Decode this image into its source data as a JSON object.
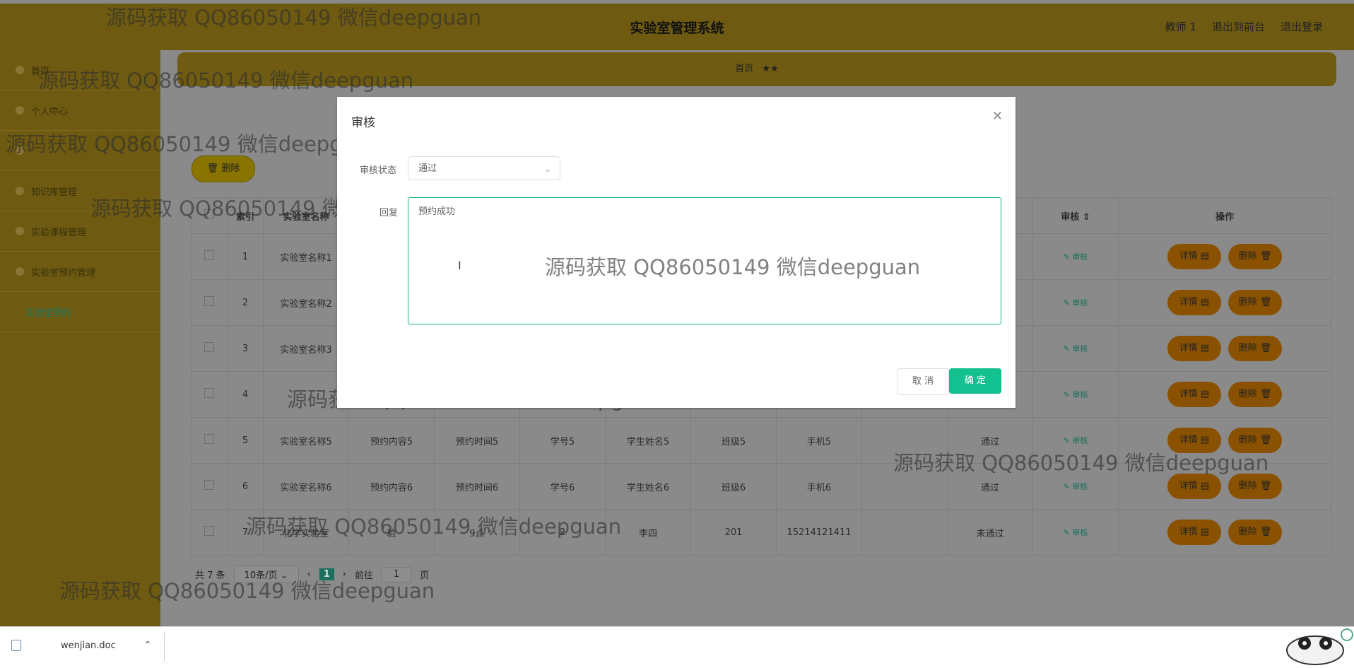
{
  "header": {
    "title": "实验室管理系统",
    "user": "教师 1",
    "to_front": "退出到前台",
    "logout": "退出登录"
  },
  "sidebar": {
    "items": [
      {
        "label": "首页",
        "icon": "home-icon"
      },
      {
        "label": "个人中心",
        "icon": "user-icon"
      },
      {
        "label": "",
        "icon": "menu-icon"
      },
      {
        "label": "知识库管理",
        "icon": "menu-icon"
      },
      {
        "label": "实验课程管理",
        "icon": "menu-icon"
      },
      {
        "label": "实验室预约管理",
        "icon": "menu-icon"
      }
    ],
    "sub_item": "实验室预约"
  },
  "breadcrumb": {
    "home": "首页",
    "separator": "★★"
  },
  "toolbar": {
    "delete_label": "删除"
  },
  "table": {
    "headers": {
      "index": "索引",
      "lab_name": "实验室名称",
      "audit": "审核",
      "actions": "操作"
    },
    "rows": [
      {
        "index": "1",
        "lab": "实验室名称1",
        "c1": "",
        "c2": "",
        "c3": "",
        "c4": "",
        "c5": "",
        "c6": "",
        "status": ""
      },
      {
        "index": "2",
        "lab": "实验室名称2",
        "c1": "",
        "c2": "",
        "c3": "",
        "c4": "",
        "c5": "",
        "c6": "",
        "status": ""
      },
      {
        "index": "3",
        "lab": "实验室名称3",
        "c1": "",
        "c2": "",
        "c3": "",
        "c4": "",
        "c5": "",
        "c6": "",
        "status": ""
      },
      {
        "index": "4",
        "lab": "",
        "c1": "",
        "c2": "",
        "c3": "",
        "c4": "",
        "c5": "",
        "c6": "",
        "status": ""
      },
      {
        "index": "5",
        "lab": "实验室名称5",
        "c1": "预约内容5",
        "c2": "预约时间5",
        "c3": "学号5",
        "c4": "学生姓名5",
        "c5": "班级5",
        "c6": "手机5",
        "status": "通过"
      },
      {
        "index": "6",
        "lab": "实验室名称6",
        "c1": "预约内容6",
        "c2": "预约时间6",
        "c3": "学号6",
        "c4": "学生姓名6",
        "c5": "班级6",
        "c6": "手机6",
        "status": "通过"
      },
      {
        "index": "7",
        "lab": "化学实验室",
        "c1": "验",
        "c2": "9点",
        "c3": "2",
        "c4": "李四",
        "c5": "201",
        "c6": "15214121411",
        "status": "未通过"
      }
    ],
    "audit_link": "审核",
    "detail_label": "详情",
    "delete_label": "删除"
  },
  "pager": {
    "total": "共 7 条",
    "page_size": "10条/页",
    "current": "1",
    "goto_prefix": "前往",
    "goto_value": "1",
    "goto_suffix": "页"
  },
  "dialog": {
    "title": "审核",
    "status_label": "审核状态",
    "status_value": "通过",
    "reply_label": "回复",
    "reply_value": "预约成功"
  },
  "dialog_footer": {
    "cancel": "取 消",
    "confirm": "确 定"
  },
  "watermark": "源码获取 QQ86050149 微信deepguan",
  "download": {
    "file_name": "wenjian.doc"
  },
  "colors": {
    "header": "#6e5a11",
    "accent": "#13c08f",
    "warning": "#8a5200"
  }
}
